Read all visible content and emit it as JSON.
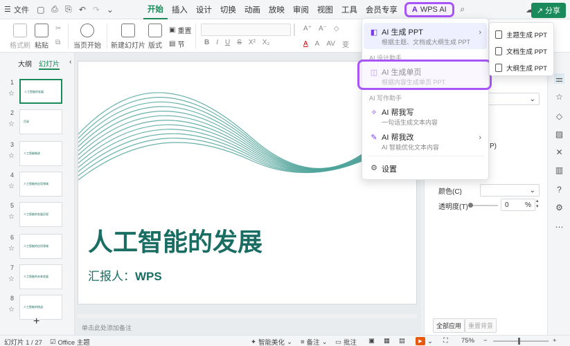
{
  "topbar": {
    "file_label": "文件",
    "tabs": [
      {
        "label": "开始",
        "active": true
      },
      {
        "label": "插入"
      },
      {
        "label": "设计"
      },
      {
        "label": "切换"
      },
      {
        "label": "动画"
      },
      {
        "label": "放映"
      },
      {
        "label": "审阅"
      },
      {
        "label": "视图"
      },
      {
        "label": "工具"
      },
      {
        "label": "会员专享"
      }
    ],
    "wps_ai_label": "WPS AI",
    "share_label": "分享"
  },
  "ribbon": {
    "format_painter": "格式刷",
    "paste": "粘贴",
    "play_from_current": "当页开始",
    "new_slide": "新建幻灯片",
    "layout": "版式",
    "section": "节",
    "reset": "重置",
    "bold": "B",
    "italic": "I",
    "underline": "U",
    "strike": "S",
    "superscript": "X²",
    "subscript": "X₂",
    "font_size_up": "A⁺",
    "font_size_down": "A⁻",
    "font_color": "A",
    "highlight": "A",
    "clear": "◇",
    "shadow": "S",
    "spacing": "AV",
    "char_spacing": "变"
  },
  "left_panel": {
    "tab_outline": "大纲",
    "tab_slides": "幻灯片",
    "slides": [
      {
        "num": "1",
        "title": "人工智能的发展"
      },
      {
        "num": "2",
        "title": "目录"
      },
      {
        "num": "3",
        "title": "人工智能概述"
      },
      {
        "num": "4",
        "title": "人工智能的应用领域"
      },
      {
        "num": "5",
        "title": "人工智能的发展历程"
      },
      {
        "num": "6",
        "title": "人工智能的应用领域"
      },
      {
        "num": "7",
        "title": "人工智能的未来发展"
      },
      {
        "num": "8",
        "title": "人工智能的挑战"
      }
    ],
    "add_label": "+"
  },
  "slide": {
    "title": "人工智能的发展",
    "subtitle_prefix": "汇报人：",
    "subtitle_name": "WPS"
  },
  "notes_placeholder": "单击此处添加备注",
  "right_panel": {
    "fill_color_label": "颜色(C)",
    "transparency_label": "透明度(T)",
    "transparency_value": "0",
    "transparency_unit": "%",
    "visible_fragment": "P)",
    "apply_all": "全部应用",
    "reset_bg": "重置背景"
  },
  "ai_menu": {
    "items": [
      {
        "label": "AI 生成 PPT",
        "desc": "根据主题、文档或大纲生成 PPT",
        "arrow": "›"
      },
      {
        "label": "AI 生成单页",
        "desc": "根据内容生成单页 PPT"
      },
      {
        "label": "AI 帮我写",
        "desc": "一句话生成文本内容"
      },
      {
        "label": "AI 帮我改",
        "desc": "AI 智能优化文本内容",
        "arrow": "›"
      },
      {
        "label": "设置"
      }
    ],
    "section_design": "AI 设计助手",
    "section_write": "AI 写作助手"
  },
  "sub_menu": {
    "items": [
      "主题生成 PPT",
      "文档生成 PPT",
      "大纲生成 PPT"
    ]
  },
  "statusbar": {
    "slide_count": "幻灯片 1 / 27",
    "theme": "Office 主题",
    "smart_beautify": "智能美化",
    "notes": "备注",
    "comments": "批注",
    "zoom": "75%"
  },
  "colors": {
    "accent": "#1a8a5a",
    "title_color": "#1a6d62",
    "ai_highlight": "#a855f7"
  }
}
